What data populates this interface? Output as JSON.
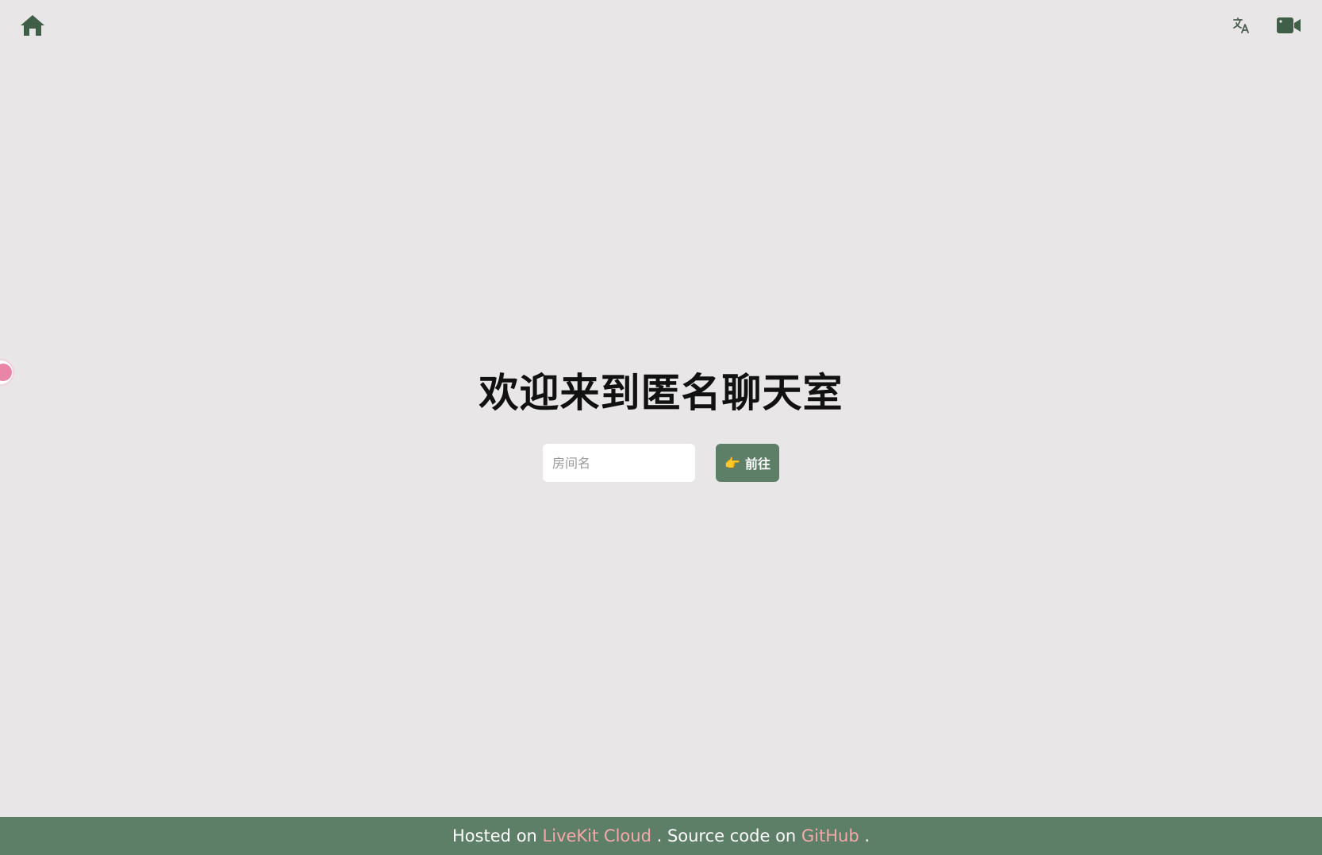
{
  "header": {
    "home_icon": "home-icon",
    "translate_icon": "translate-icon",
    "video_icon": "video-camera-icon"
  },
  "side_widget": {
    "icon": "translate-badge-icon"
  },
  "main": {
    "title": "欢迎来到匿名聊天室",
    "room_input": {
      "value": "",
      "placeholder": "房间名"
    },
    "go_button": {
      "emoji": "👉",
      "label": "前往"
    }
  },
  "footer": {
    "prefix": "Hosted on ",
    "livekit_link": "LiveKit Cloud",
    "middle": " . Source code on ",
    "github_link": "GitHub",
    "suffix": " ."
  },
  "colors": {
    "background": "#e8e6e6",
    "accent": "#5d7f68",
    "link": "#f5a8a8",
    "icon": "#3f5f48"
  }
}
